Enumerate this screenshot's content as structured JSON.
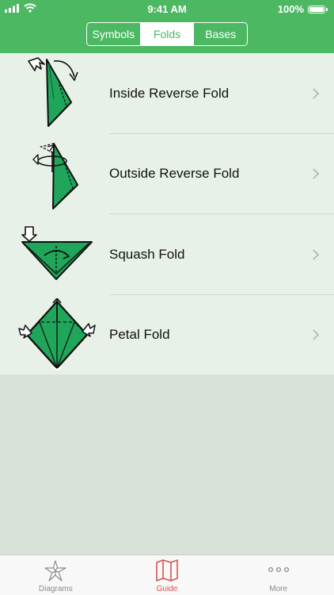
{
  "status_bar": {
    "time": "9:41 AM",
    "battery": "100%"
  },
  "segmented_control": {
    "items": [
      {
        "label": "Symbols",
        "selected": false
      },
      {
        "label": "Folds",
        "selected": true
      },
      {
        "label": "Bases",
        "selected": false
      }
    ]
  },
  "folds": [
    {
      "label": "Inside Reverse Fold",
      "icon": "inside-reverse-fold-diagram"
    },
    {
      "label": "Outside Reverse Fold",
      "icon": "outside-reverse-fold-diagram"
    },
    {
      "label": "Squash Fold",
      "icon": "squash-fold-diagram"
    },
    {
      "label": "Petal Fold",
      "icon": "petal-fold-diagram"
    }
  ],
  "tab_bar": {
    "items": [
      {
        "label": "Diagrams",
        "icon": "origami-star-icon",
        "selected": false
      },
      {
        "label": "Guide",
        "icon": "map-icon",
        "selected": true
      },
      {
        "label": "More",
        "icon": "more-dots-icon",
        "selected": false
      }
    ]
  },
  "colors": {
    "header": "#4cb862",
    "list_background": "#e8f1e8",
    "empty_background": "#d8e2d8",
    "paper_green": "#1fa65a",
    "tab_active": "#d9534f"
  }
}
